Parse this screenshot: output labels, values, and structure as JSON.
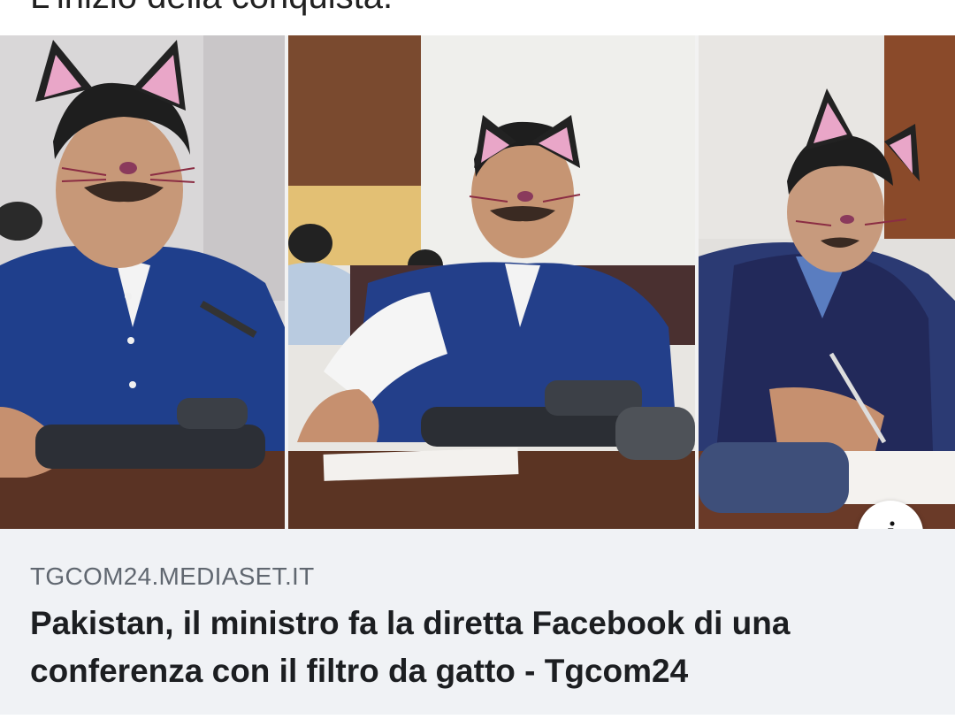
{
  "previous_post": {
    "text": "L'inizio della conquista."
  },
  "link_preview": {
    "source": "TGCOM24.MEDIASET.IT",
    "headline": "Pakistan, il ministro fa la diretta Facebook di una conferenza con il filtro da gatto - Tgcom24",
    "info_icon": "info-icon",
    "info_label": "i"
  },
  "colors": {
    "caption_background": "#f0f2f5",
    "source_text": "#606770",
    "headline_text": "#1c1e21",
    "vest_blue": "#1f3f8c"
  }
}
